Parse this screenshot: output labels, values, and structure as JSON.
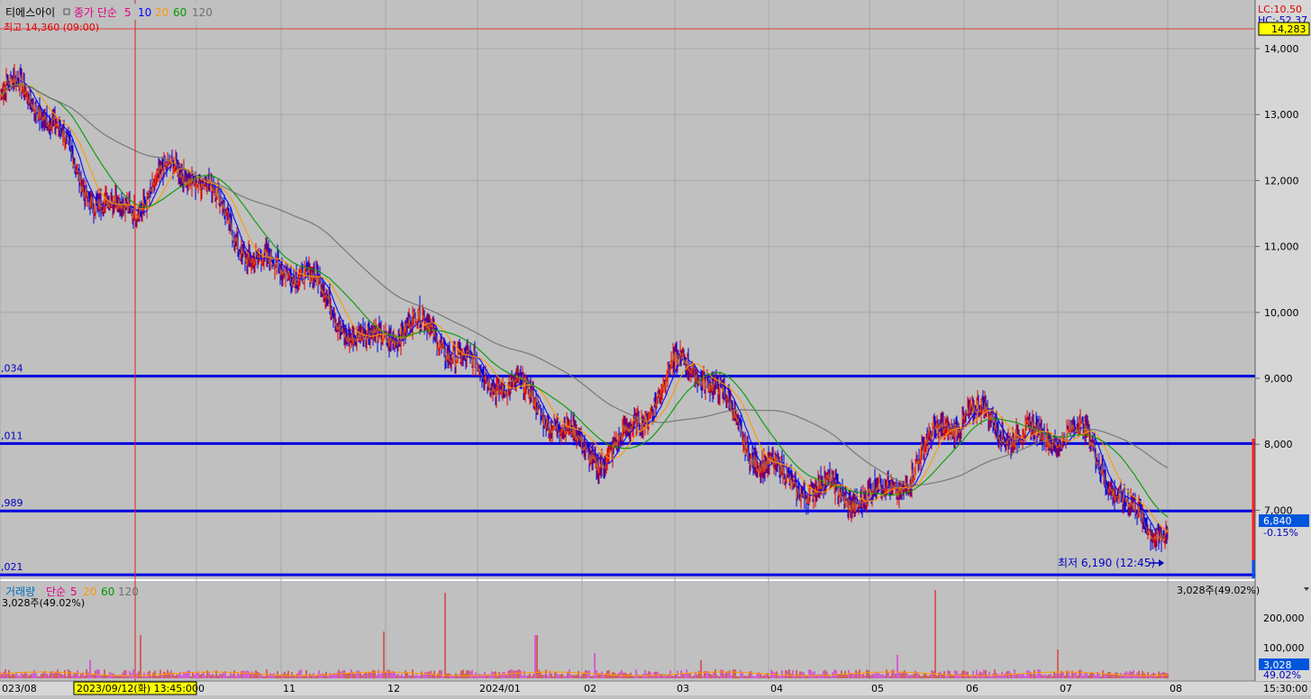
{
  "price_panel": {
    "stock_name": "티에스아이",
    "indicator_label": "종가 단순",
    "ma_periods": [
      "5",
      "10",
      "20",
      "60",
      "120"
    ],
    "ma_colors": [
      "#ff00ff",
      "#0000ff",
      "#ff9900",
      "#009900",
      "#707070"
    ],
    "high_label": "최고 14,360 (09:00)",
    "low_label": "최저 6,190 (12:45)",
    "lc_label": "LC:10.50",
    "hc_label": "HC:-52.37",
    "top_price_box": "14,283",
    "current_price_box": "6,840",
    "current_change": "-0.15%",
    "y_ticks": [
      "14,000",
      "13,000",
      "12,000",
      "11,000",
      "10,000",
      "9,000",
      "8,000",
      "7,000"
    ],
    "h_lines": [
      {
        "label": ",034",
        "price": 9034
      },
      {
        "label": ",011",
        "price": 8011
      },
      {
        "label": ",989",
        "price": 6989
      },
      {
        "label": ",021",
        "price": 6021
      }
    ],
    "high_price": 14360,
    "low_price": 6190,
    "last_price": 6840
  },
  "volume_panel": {
    "title": "거래량",
    "indicator_label": "단순",
    "ma_periods": [
      "5",
      "20",
      "60",
      "120"
    ],
    "ma_colors": [
      "#ff00ff",
      "#ff9900",
      "#009900",
      "#707070"
    ],
    "volume_text": "3,028주(49.02%)",
    "volume_text_right": "3,028주(49.02%)",
    "y_ticks": [
      "200,000",
      "100,000"
    ],
    "current_box": "3,028",
    "current_pct": "49.02%"
  },
  "x_axis": {
    "labels": [
      "023/08",
      "0",
      "11",
      "12",
      "2024/01",
      "02",
      "03",
      "04",
      "05",
      "06",
      "07",
      "08"
    ],
    "cursor_label": "2023/09/12(화) 13:45:00",
    "right_label": "15:30:00"
  },
  "chart_data": {
    "type": "line",
    "x": [
      "2023/08",
      "2023/09",
      "2023/10",
      "2023/11",
      "2023/12",
      "2024/01",
      "2024/02",
      "2024/03",
      "2024/04",
      "2024/05",
      "2024/06",
      "2024/07",
      "2024/08"
    ],
    "series": [
      {
        "values": [
          13300,
          11600,
          12100,
          10500,
          9700,
          9300,
          7900,
          9000,
          7100,
          7500,
          8500,
          8000,
          6840
        ]
      }
    ],
    "ylim": [
      6000,
      14400
    ]
  }
}
